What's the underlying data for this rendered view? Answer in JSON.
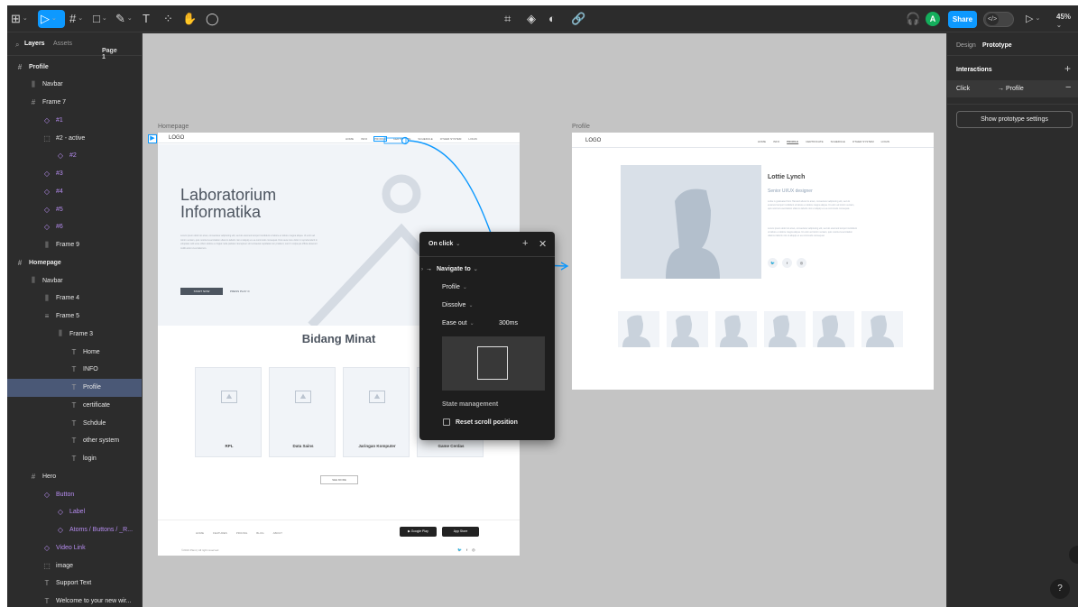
{
  "toolbar": {
    "left_tools": [
      {
        "icon": "figma-menu-icon",
        "glyph": "⊞",
        "caret": true
      },
      {
        "icon": "move-tool-icon",
        "glyph": "▷",
        "caret": true
      },
      {
        "icon": "frame-tool-icon",
        "glyph": "#",
        "caret": true
      },
      {
        "icon": "rectangle-tool-icon",
        "glyph": "□",
        "caret": true
      },
      {
        "icon": "pen-tool-icon",
        "glyph": "✎",
        "caret": true
      },
      {
        "icon": "text-tool-icon",
        "glyph": "T",
        "caret": false
      },
      {
        "icon": "resources-icon",
        "glyph": "⁘",
        "caret": false
      },
      {
        "icon": "hand-tool-icon",
        "glyph": "✋",
        "caret": false
      },
      {
        "icon": "comment-icon",
        "glyph": "◯",
        "caret": false
      }
    ],
    "center_tools": [
      {
        "icon": "crop-icon",
        "glyph": "⌗"
      },
      {
        "icon": "component-icon",
        "glyph": "◈"
      },
      {
        "icon": "contrast-icon",
        "glyph": "◐"
      },
      {
        "icon": "link-icon",
        "glyph": "🔗"
      }
    ],
    "avatar_letter": "A",
    "share_label": "Share",
    "devmode_glyph": "</>",
    "zoom_label": "45%"
  },
  "left_panel": {
    "search_glyph": "⌕",
    "tab_layers": "Layers",
    "tab_assets": "Assets",
    "page_label": "Page 1",
    "layers": [
      {
        "label": "Profile",
        "icon": "#",
        "depth": 0,
        "type": "frame",
        "bold": true
      },
      {
        "label": "Navbar",
        "icon": "⫼",
        "depth": 1,
        "type": "frame"
      },
      {
        "label": "Frame 7",
        "icon": "#",
        "depth": 1,
        "type": "frame"
      },
      {
        "label": "#1",
        "icon": "◇",
        "depth": 2,
        "type": "component"
      },
      {
        "label": "#2 - active",
        "icon": "⬚",
        "depth": 2,
        "type": "frame"
      },
      {
        "label": "#2",
        "icon": "◇",
        "depth": 3,
        "type": "component"
      },
      {
        "label": "#3",
        "icon": "◇",
        "depth": 2,
        "type": "component"
      },
      {
        "label": "#4",
        "icon": "◇",
        "depth": 2,
        "type": "component"
      },
      {
        "label": "#5",
        "icon": "◇",
        "depth": 2,
        "type": "component"
      },
      {
        "label": "#6",
        "icon": "◇",
        "depth": 2,
        "type": "component"
      },
      {
        "label": "Frame 9",
        "icon": "⫼",
        "depth": 2,
        "type": "frame"
      },
      {
        "label": "Homepage",
        "icon": "#",
        "depth": 0,
        "type": "frame",
        "bold": true
      },
      {
        "label": "Navbar",
        "icon": "⫼",
        "depth": 1,
        "type": "frame"
      },
      {
        "label": "Frame 4",
        "icon": "⫼",
        "depth": 2,
        "type": "frame"
      },
      {
        "label": "Frame 5",
        "icon": "≡",
        "depth": 2,
        "type": "frame"
      },
      {
        "label": "Frame 3",
        "icon": "⫼",
        "depth": 3,
        "type": "frame"
      },
      {
        "label": "Home",
        "icon": "T",
        "depth": 4,
        "type": "text"
      },
      {
        "label": "INFO",
        "icon": "T",
        "depth": 4,
        "type": "text"
      },
      {
        "label": "Profile",
        "icon": "T",
        "depth": 4,
        "type": "text",
        "selected": true
      },
      {
        "label": "certificate",
        "icon": "T",
        "depth": 4,
        "type": "text"
      },
      {
        "label": "Schdule",
        "icon": "T",
        "depth": 4,
        "type": "text"
      },
      {
        "label": "other system",
        "icon": "T",
        "depth": 4,
        "type": "text"
      },
      {
        "label": "login",
        "icon": "T",
        "depth": 4,
        "type": "text"
      },
      {
        "label": "Hero",
        "icon": "#",
        "depth": 1,
        "type": "frame"
      },
      {
        "label": "Button",
        "icon": "◇",
        "depth": 2,
        "type": "component"
      },
      {
        "label": "Label",
        "icon": "◇",
        "depth": 3,
        "type": "component"
      },
      {
        "label": "Atoms / Buttons / _R...",
        "icon": "◇",
        "depth": 3,
        "type": "component"
      },
      {
        "label": "Video Link",
        "icon": "◇",
        "depth": 2,
        "type": "component"
      },
      {
        "label": "image",
        "icon": "⬚",
        "depth": 2,
        "type": "frame"
      },
      {
        "label": "Support Text",
        "icon": "T",
        "depth": 2,
        "type": "text"
      },
      {
        "label": "Welcome to your new wir...",
        "icon": "T",
        "depth": 2,
        "type": "text"
      }
    ]
  },
  "canvas": {
    "homepage_label": "Homepage",
    "profile_label": "Profile",
    "homepage": {
      "logo": "LOGO",
      "nav": [
        "HOME",
        "INFO",
        "PROFILE",
        "CERTIFICATE",
        "SCHEDULE",
        "OTHER SYSTEM",
        "LOGIN"
      ],
      "hero_title_line1": "Laboratorium",
      "hero_title_line2": "Informatika",
      "hero_body": "Lorem ipsum dolor sit amet, consectetur adipiscing elit, sed do eiusmod tempor incididunt ut labore et dolore magna aliqua. Ut enim ad minim veniam, quis nostrud exercitation ullamco laboris nisi ut aliquip ex ea commodo consequat. Duis aute irure dolor in reprehenderit in voluptate velit esse cillum dolore eu fugiat nulla pariatur. Excepteur sint occaecat cupidatat non proident, sunt in culpa qui officia deserunt mollit anim id est laborum.",
      "hero_button": "START NOW",
      "hero_link": "PRESS PLAY",
      "section_title": "Bidang Minat",
      "cards": [
        "RPL",
        "Data Sains",
        "Jaringan Komputer",
        "Game Cerdas"
      ],
      "see_more": "SEE MORE",
      "footer_links": [
        "HOME",
        "FEATURES",
        "PRICING",
        "BLOG",
        "ABOUT"
      ],
      "google_play": "Google Play",
      "app_store": "App Store",
      "copyright": "©2019 Plant | All right reserved",
      "social": [
        "🐦",
        "f",
        "◎"
      ]
    },
    "profile": {
      "logo": "LOGO",
      "nav": [
        "HOME",
        "INFO",
        "PROFILE",
        "CERTIFICATE",
        "SCHEDULE",
        "OTHER SYSTEM",
        "LOGIN"
      ],
      "name": "Lottie Lynch",
      "role": "Senior UI/UX designer",
      "bio1": "Lottie is graduated from Harvard about its amet, consectetur adipiscing elit, sed do eiusmod tempor incididunt ut labore et dolore magna aliqua. Ut enim ad minim veniam, quis nostrud exercitation ullamco laboris nisi ut aliquip ex ea commodo consequat.",
      "bio2": "Lorem ipsum dolor sit amet, consectetur adipiscing elit, sed do eiusmod tempor incididunt ut labore et dolore magna aliqua. Ut enim ad minim veniam, quis nostrud exercitation ullamco laboris nisi ut aliquip ex ea commodo consequat.",
      "social": [
        "🐦",
        "f",
        "◎"
      ]
    }
  },
  "popup": {
    "trigger": "On click",
    "action": "Navigate to",
    "destination": "Profile",
    "animation": "Dissolve",
    "easing": "Ease out",
    "duration": "300ms",
    "state_heading": "State management",
    "reset_scroll": "Reset scroll position",
    "reset_scroll_checked": false
  },
  "right_panel": {
    "tab_design": "Design",
    "tab_prototype": "Prototype",
    "interactions_heading": "Interactions",
    "trigger": "Click",
    "target": "→ Profile",
    "settings_button": "Show prototype settings",
    "help_glyph": "?"
  },
  "colors": {
    "accent": "#0d99ff",
    "selected_layer": "#4a5876",
    "component": "#b68cf0",
    "canvas": "#c4c4c4"
  }
}
